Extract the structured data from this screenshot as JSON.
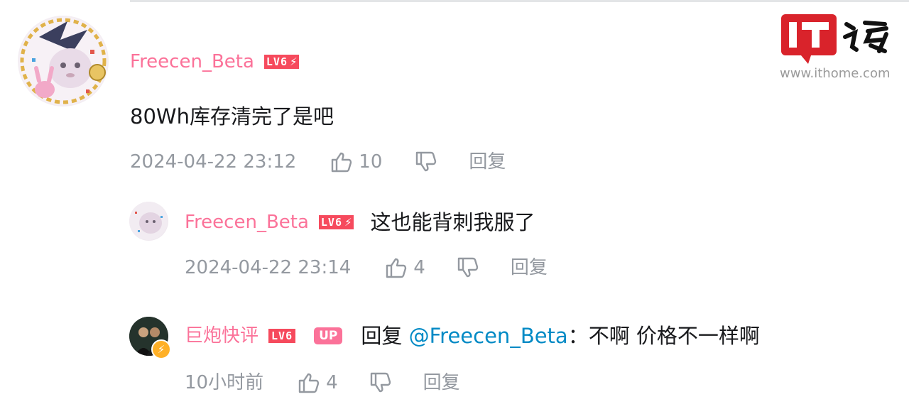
{
  "watermark": {
    "logo_text": "IT之家",
    "url": "www.ithome.com"
  },
  "comment": {
    "username": "Freecen_Beta",
    "level": "LV6",
    "content": "80Wh库存清完了是吧",
    "time": "2024-04-22 23:12",
    "likes": "10",
    "reply_label": "回复",
    "avatar_icon": "anime-character-avatar"
  },
  "replies": [
    {
      "username": "Freecen_Beta",
      "level": "LV6",
      "content": "这也能背刺我服了",
      "time": "2024-04-22 23:14",
      "likes": "4",
      "reply_label": "回复"
    },
    {
      "username": "巨炮快评",
      "level": "LV6",
      "up_badge": "UP",
      "reply_prefix": "回复",
      "mention": "@Freecen_Beta",
      "content": "：不啊 价格不一样啊",
      "time": "10小时前",
      "likes": "4",
      "reply_label": "回复"
    }
  ],
  "colors": {
    "username": "#fb7299",
    "level_badge": "#f64a5d",
    "meta": "#9499a0",
    "mention": "#008ac5",
    "logo_red": "#d9232b"
  }
}
